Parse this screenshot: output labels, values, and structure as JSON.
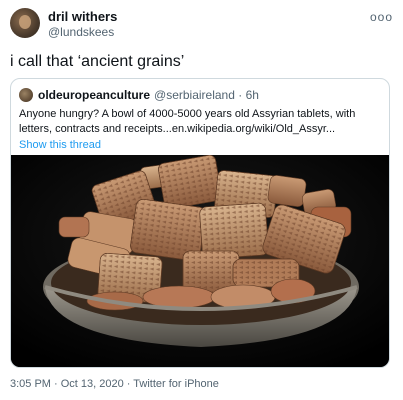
{
  "tweet": {
    "author_name": "dril withers",
    "author_handle": "@lundskees",
    "more_glyph": "ooo",
    "text": "i call that ‘ancient grains’",
    "meta": "3:05 PM · Oct 13, 2020 · Twitter for iPhone"
  },
  "quoted": {
    "author_name": "oldeuropeanculture",
    "handle_time": "@serbiaireland · 6h",
    "text": "Anyone hungry? A bowl of 4000-5000 years old Assyrian tablets, with letters, contracts and receipts...en.wikipedia.org/wiki/Old_Assyr...",
    "show_thread": "Show this thread"
  },
  "colors": {
    "link": "#1d9bf0",
    "secondary_text": "#536471",
    "border": "#cfd9de"
  }
}
